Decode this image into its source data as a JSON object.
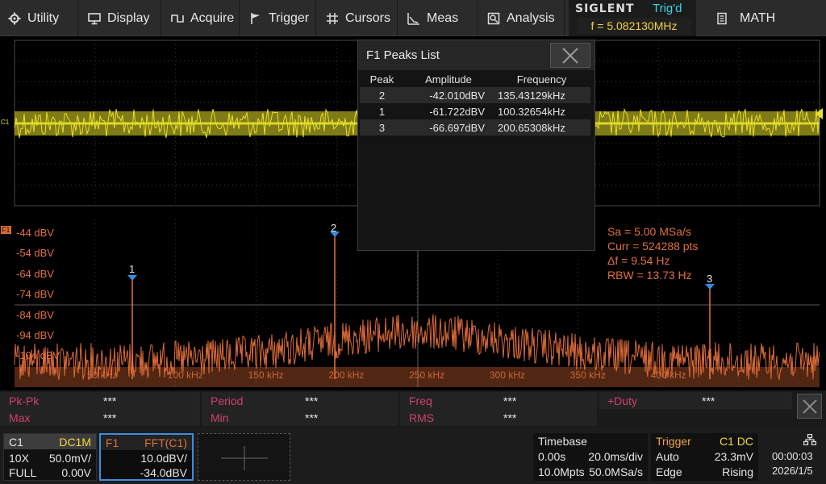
{
  "menu": {
    "utility": "Utility",
    "display": "Display",
    "acquire": "Acquire",
    "trigger": "Trigger",
    "cursors": "Cursors",
    "meas": "Meas",
    "analysis": "Analysis",
    "math": "MATH"
  },
  "brand": {
    "logo": "SIGLENT",
    "trig_status": "Trig'd",
    "frequency": "f = 5.082130MHz"
  },
  "waveform": {
    "c1_marker": "C1",
    "f1_marker": "F1",
    "db_labels": [
      "-44 dBV",
      "-54 dBV",
      "-64 dBV",
      "-74 dBV",
      "-84 dBV",
      "-94 dBV",
      "-104 dBV"
    ],
    "freq_ticks": [
      "50 kHz",
      "100 kHz",
      "150 kHz",
      "200 kHz",
      "250 kHz",
      "300 kHz",
      "350 kHz",
      "400 kHz"
    ],
    "colors": {
      "channel1": "#e8e02a",
      "fft": "#e8703a",
      "marker": "#2f8fe0"
    }
  },
  "peak_markers": [
    "1",
    "2",
    "3"
  ],
  "fft_info": {
    "sa": "Sa =  5.00 MSa/s",
    "curr": "Curr = 524288 pts",
    "df": "Δf =  9.54 Hz",
    "rbw": "RBW =  13.73 Hz"
  },
  "peaks_list": {
    "title": "F1 Peaks List",
    "headers": [
      "Peak",
      "Amplitude",
      "Frequency"
    ],
    "rows": [
      {
        "peak": "2",
        "amplitude": "-42.010dBV",
        "frequency": "135.43129kHz"
      },
      {
        "peak": "1",
        "amplitude": "-61.722dBV",
        "frequency": "100.32654kHz"
      },
      {
        "peak": "3",
        "amplitude": "-66.697dBV",
        "frequency": "200.65308kHz"
      }
    ]
  },
  "measurements": [
    {
      "label": "Pk-Pk",
      "value": "***"
    },
    {
      "label": "Period",
      "value": "***"
    },
    {
      "label": "Freq",
      "value": "***"
    },
    {
      "label": "+Duty",
      "value": "***"
    },
    {
      "label": "Max",
      "value": "***"
    },
    {
      "label": "Min",
      "value": "***"
    },
    {
      "label": "RMS",
      "value": "***"
    }
  ],
  "c1_box": {
    "name": "C1",
    "coupling": "DC1M",
    "probe": "10X",
    "scale": "50.0mV/",
    "bw": "FULL",
    "offset": "0.00V"
  },
  "f1_box": {
    "name": "F1",
    "func": "FFT(C1)",
    "scale": "10.0dBV/",
    "ref": "-34.0dBV"
  },
  "timebase": {
    "title": "Timebase",
    "delay": "0.00s",
    "scale": "20.0ms/div",
    "memory": "10.0Mpts",
    "rate": "50.0MSa/s"
  },
  "trigger": {
    "title": "Trigger",
    "source": "C1 DC",
    "mode": "Auto",
    "level": "23.3mV",
    "type": "Edge",
    "slope": "Rising"
  },
  "clock": {
    "time": "00:00:03",
    "date": "2026/1/5"
  }
}
